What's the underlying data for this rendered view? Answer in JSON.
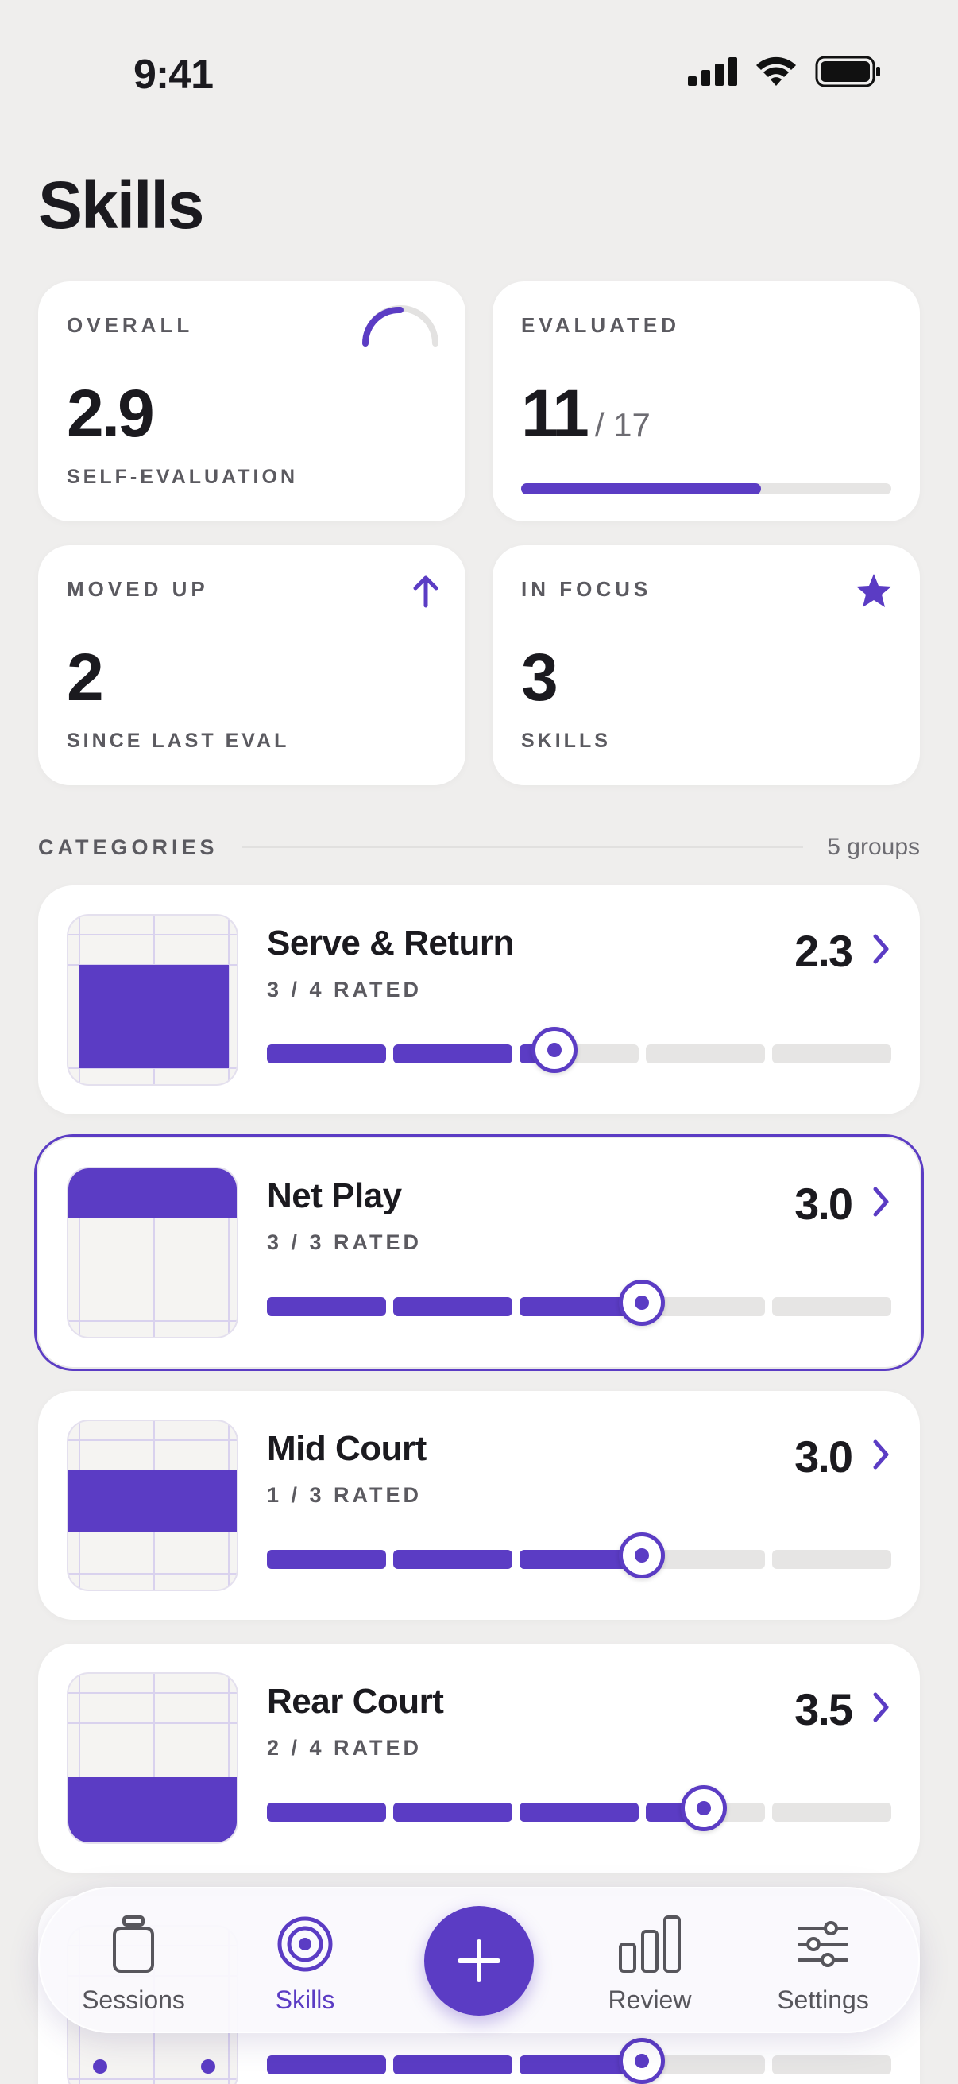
{
  "status_bar": {
    "time": "9:41"
  },
  "page_title": "Skills",
  "stats": {
    "overall": {
      "label": "OVERALL",
      "value": "2.9",
      "sub": "SELF-EVALUATION",
      "gauge_fraction": 0.5
    },
    "evaluated": {
      "label": "EVALUATED",
      "value": "11",
      "of": "/ 17",
      "progress_fraction": 0.647
    },
    "moved_up": {
      "label": "MOVED UP",
      "value": "2",
      "sub": "SINCE LAST EVAL",
      "icon": "arrow-up-icon"
    },
    "in_focus": {
      "label": "IN FOCUS",
      "value": "3",
      "sub": "SKILLS",
      "icon": "star-icon"
    }
  },
  "categories": {
    "title": "CATEGORIES",
    "count": "5 groups",
    "items": [
      {
        "name": "Serve & Return",
        "rated": "3 / 4 RATED",
        "score": "2.3",
        "level_fraction": 0.46,
        "zone": "front"
      },
      {
        "name": "Net Play",
        "rated": "3 / 3 RATED",
        "score": "3.0",
        "level_fraction": 0.6,
        "zone": "net",
        "selected": true
      },
      {
        "name": "Mid Court",
        "rated": "1 / 3 RATED",
        "score": "3.0",
        "level_fraction": 0.6,
        "zone": "mid"
      },
      {
        "name": "Rear Court",
        "rated": "2 / 4 RATED",
        "score": "3.5",
        "level_fraction": 0.7,
        "zone": "rear"
      },
      {
        "name": "",
        "rated": "",
        "score": "",
        "level_fraction": 0.6,
        "zone": "dots"
      }
    ]
  },
  "tabbar": {
    "sessions": "Sessions",
    "skills": "Skills",
    "review": "Review",
    "settings": "Settings",
    "active": "skills"
  },
  "colors": {
    "accent": "#5b3cc4",
    "track": "#e6e5e4",
    "background": "#efeeed"
  }
}
